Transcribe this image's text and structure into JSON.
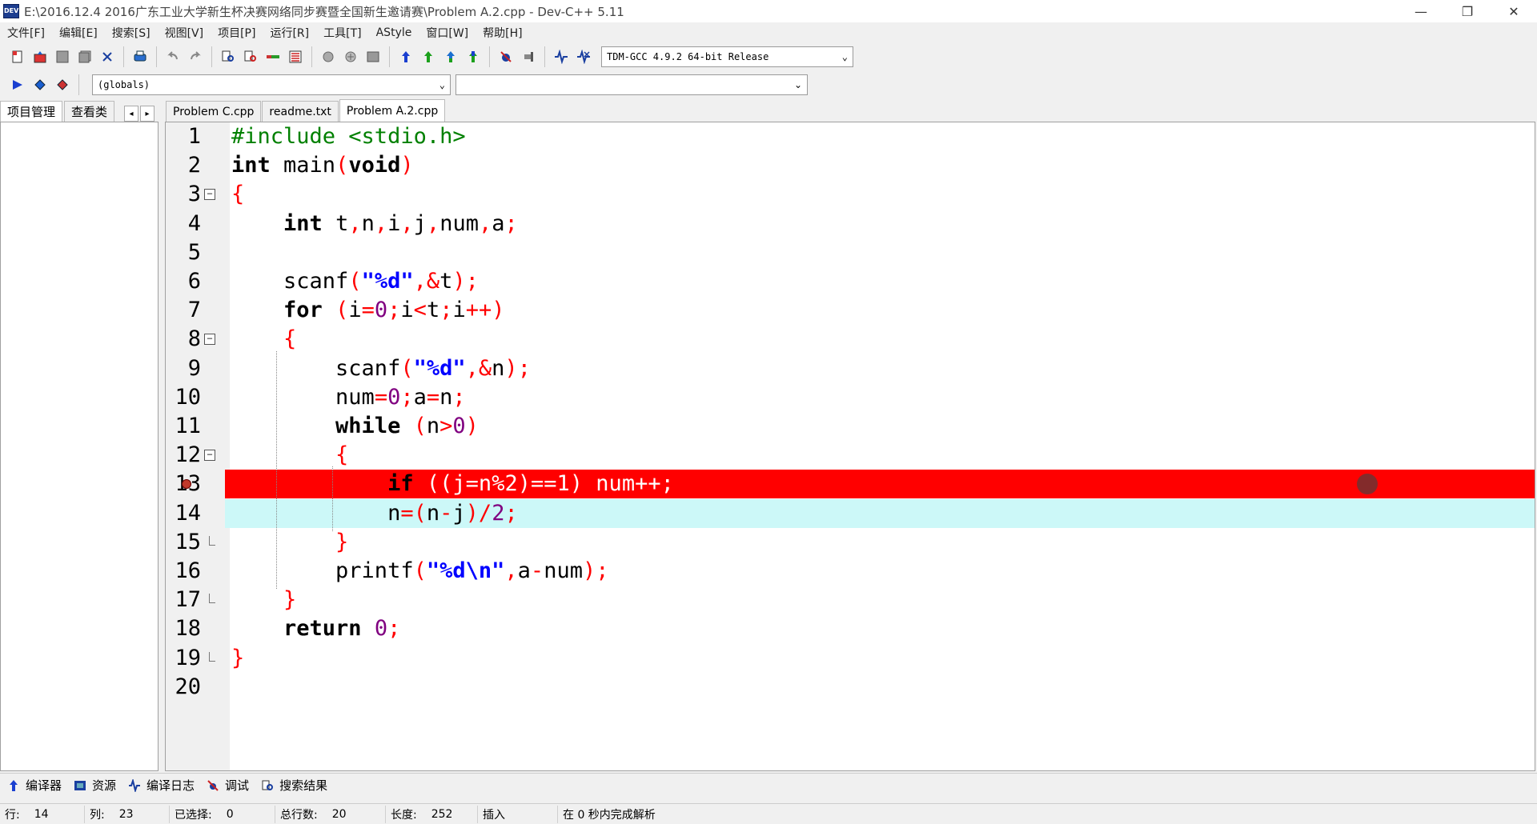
{
  "window": {
    "app_icon_text": "DEV",
    "title": "E:\\2016.12.4 2016广东工业大学新生杯决赛网络同步赛暨全国新生邀请赛\\Problem A.2.cpp - Dev-C++ 5.11",
    "minimize": "—",
    "restore": "❐",
    "close": "✕"
  },
  "menu": [
    "文件[F]",
    "编辑[E]",
    "搜索[S]",
    "视图[V]",
    "项目[P]",
    "运行[R]",
    "工具[T]",
    "AStyle",
    "窗口[W]",
    "帮助[H]"
  ],
  "toolbar": {
    "compiler": "TDM-GCC 4.9.2 64-bit Release",
    "scope": "(globals)",
    "function": ""
  },
  "side_tabs": [
    "项目管理",
    "查看类"
  ],
  "nav_prev": "◂",
  "nav_next": "▸",
  "file_tabs": [
    "Problem C.cpp",
    "readme.txt",
    "Problem A.2.cpp"
  ],
  "active_file_tab": 2,
  "line_numbers": [
    "1",
    "2",
    "3",
    "4",
    "5",
    "6",
    "7",
    "8",
    "9",
    "10",
    "11",
    "12",
    "13",
    "14",
    "15",
    "16",
    "17",
    "18",
    "19",
    "20"
  ],
  "code_lines": [
    "#include <stdio.h>",
    "int main(void)",
    "{",
    "    int t,n,i,j,num,a;",
    "",
    "    scanf(\"%d\",&t);",
    "    for (i=0;i<t;i++)",
    "    {",
    "        scanf(\"%d\",&n);",
    "        num=0;a=n;",
    "        while (n>0)",
    "        {",
    "            if ((j=n%2)==1) num++;",
    "            n=(n-j)/2;",
    "        }",
    "        printf(\"%d\\n\",a-num);",
    "    }",
    "    return 0;",
    "}",
    ""
  ],
  "fold_open_symbol": "−",
  "breakpoint_line": 13,
  "current_line": 14,
  "bottom_tabs": [
    {
      "icon": "compiler-icon",
      "label": "编译器"
    },
    {
      "icon": "resources-icon",
      "label": "资源"
    },
    {
      "icon": "compile-log-icon",
      "label": "编译日志"
    },
    {
      "icon": "debug-icon",
      "label": "调试"
    },
    {
      "icon": "search-results-icon",
      "label": "搜索结果"
    }
  ],
  "status": {
    "row_label": "行:",
    "row_value": "14",
    "col_label": "列:",
    "col_value": "23",
    "sel_label": "已选择:",
    "sel_value": "0",
    "total_label": "总行数:",
    "total_value": "20",
    "len_label": "长度:",
    "len_value": "252",
    "mode": "插入",
    "parse": "在 0 秒内完成解析"
  },
  "colors": {
    "breakpoint_bg": "#ff0000",
    "current_line_bg": "#ccf8f8",
    "preprocessor": "#008000",
    "symbol": "#ff0000",
    "string": "#0000ff",
    "number": "#800080"
  }
}
